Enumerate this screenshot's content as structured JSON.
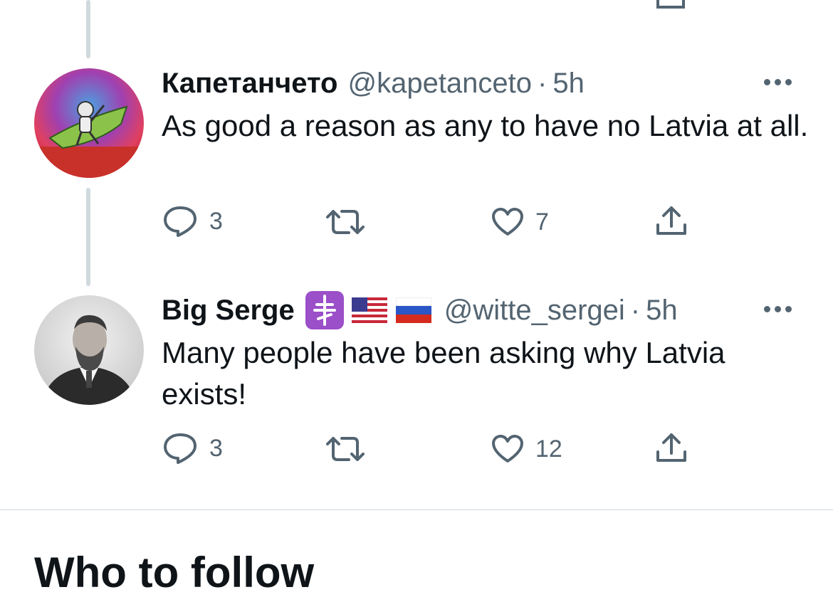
{
  "tweets": [
    {
      "display_name": "Капетанчето",
      "handle": "@kapetanceto",
      "separator": "·",
      "time": "5h",
      "text": "As good a reason as any to have no Latvia at all.",
      "replies": "3",
      "retweets": "",
      "likes": "7",
      "avatar_icon": "astronaut-riding-shark-avatar"
    },
    {
      "display_name": "Big Serge",
      "badges": [
        "orthodox-cross-icon",
        "us-flag-icon",
        "russia-flag-icon"
      ],
      "handle": "@witte_sergei",
      "separator": "·",
      "time": "5h",
      "text": "Many people have been asking why Latvia exists!",
      "replies": "3",
      "retweets": "",
      "likes": "12",
      "avatar_icon": "bearded-man-photo-avatar"
    }
  ],
  "section": {
    "title": "Who to follow"
  },
  "colors": {
    "text": "#0f1419",
    "secondary": "#536471",
    "line": "#cfd9de"
  }
}
